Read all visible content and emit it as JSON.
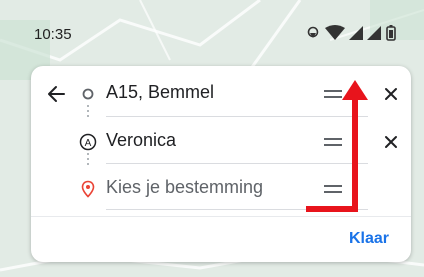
{
  "status_bar": {
    "time": "10:35",
    "icons": [
      "location-icon",
      "wifi-icon",
      "signal-icon",
      "signal-icon",
      "battery-icon"
    ]
  },
  "route": {
    "stops": [
      {
        "label": "A15, Bemmel",
        "icon": "origin-circle-icon",
        "placeholder": false
      },
      {
        "label": "Veronica",
        "icon": "waypoint-a-icon",
        "placeholder": false
      },
      {
        "label": "Kies je bestemming",
        "icon": "destination-pin-icon",
        "placeholder": true
      }
    ]
  },
  "actions": {
    "done_label": "Klaar"
  },
  "colors": {
    "accent": "#1a73e8",
    "annotation_arrow": "#e8141c",
    "destination_pin": "#ea4335",
    "map_background": "#dfe9e3"
  }
}
